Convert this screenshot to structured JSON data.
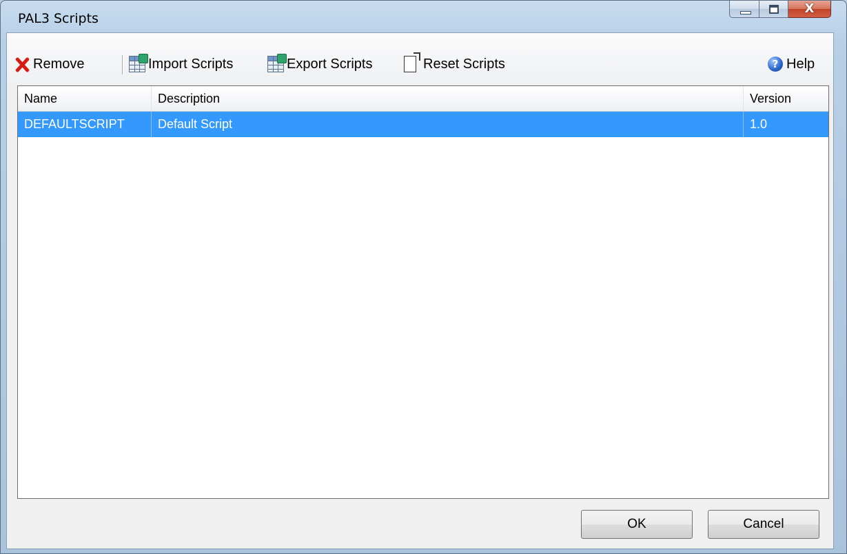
{
  "window": {
    "title": "PAL3 Scripts",
    "close_glyph": "X"
  },
  "toolbar": {
    "remove_label": "Remove",
    "import_label": "Import Scripts",
    "export_label": "Export Scripts",
    "reset_label": "Reset Scripts",
    "help_label": "Help",
    "help_glyph": "?"
  },
  "list": {
    "columns": [
      "Name",
      "Description",
      "Version"
    ],
    "rows": [
      {
        "name": "DEFAULTSCRIPT",
        "description": "Default Script",
        "version": "1.0",
        "selected": true
      }
    ]
  },
  "footer": {
    "ok_label": "OK",
    "cancel_label": "Cancel"
  },
  "colors": {
    "selection": "#3399ff",
    "remove_icon": "#d81c14"
  },
  "icons": [
    "remove-x-icon",
    "import-table-icon",
    "export-table-icon",
    "reset-document-icon",
    "help-icon"
  ]
}
